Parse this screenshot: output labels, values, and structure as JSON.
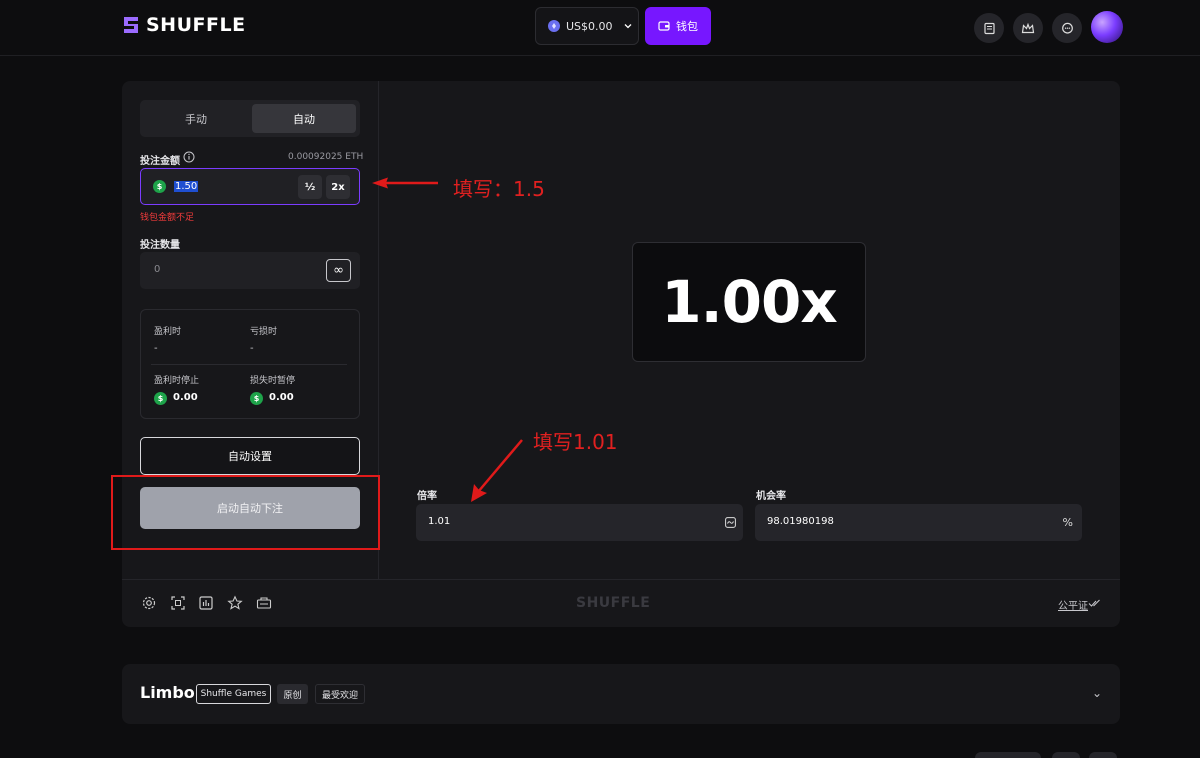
{
  "header": {
    "brand": "SHUFFLE",
    "balance": "US$0.00",
    "wallet_label": "钱包",
    "icons": [
      "receipt-icon",
      "crown-icon",
      "chat-icon"
    ]
  },
  "panel": {
    "tabs": [
      {
        "label": "手动",
        "active": false
      },
      {
        "label": "自动",
        "active": true
      }
    ],
    "bet_amount": {
      "label": "投注金额",
      "eth_value": "0.00092025 ETH",
      "value": "1.50",
      "half_label": "½",
      "double_label": "2x",
      "error": "钱包金额不足"
    },
    "bet_count": {
      "label": "投注数量",
      "value": "0",
      "infinite_symbol": "∞"
    },
    "stop_conditions": {
      "on_profit": "盈利时",
      "on_profit_value": "-",
      "on_loss": "亏损时",
      "on_loss_value": "-",
      "stop_on_profit": "盈利时停止",
      "stop_on_profit_value": "0.00",
      "pause_on_loss": "损失时暂停",
      "pause_on_loss_value": "0.00"
    },
    "auto_settings_label": "自动设置",
    "start_auto_label": "启动自动下注",
    "coin_symbol": "$"
  },
  "game": {
    "multiplier_display": "1.00x",
    "target_multiplier_label": "倍率",
    "target_multiplier_value": "1.01",
    "win_chance_label": "机会率",
    "win_chance_value": "98.01980198",
    "percent_symbol": "%"
  },
  "bottom_bar": {
    "brand": "SHUFFLE",
    "fairness_label": "公平证",
    "icons": [
      "settings-icon",
      "fullscreen-icon",
      "stats-icon",
      "star-icon",
      "keyboard-icon"
    ]
  },
  "annotations": {
    "bet_hint": "填写：1.5",
    "multiplier_hint": "填写1.01"
  },
  "info": {
    "title": "Limbo",
    "chips": [
      "Shuffle Games",
      "原创",
      "最受欢迎"
    ],
    "chevron": "⌄"
  },
  "colors": {
    "accent": "#7717ff",
    "error": "#f23b3b",
    "annotation": "#e01a1a",
    "coin": "#1ea34a"
  }
}
